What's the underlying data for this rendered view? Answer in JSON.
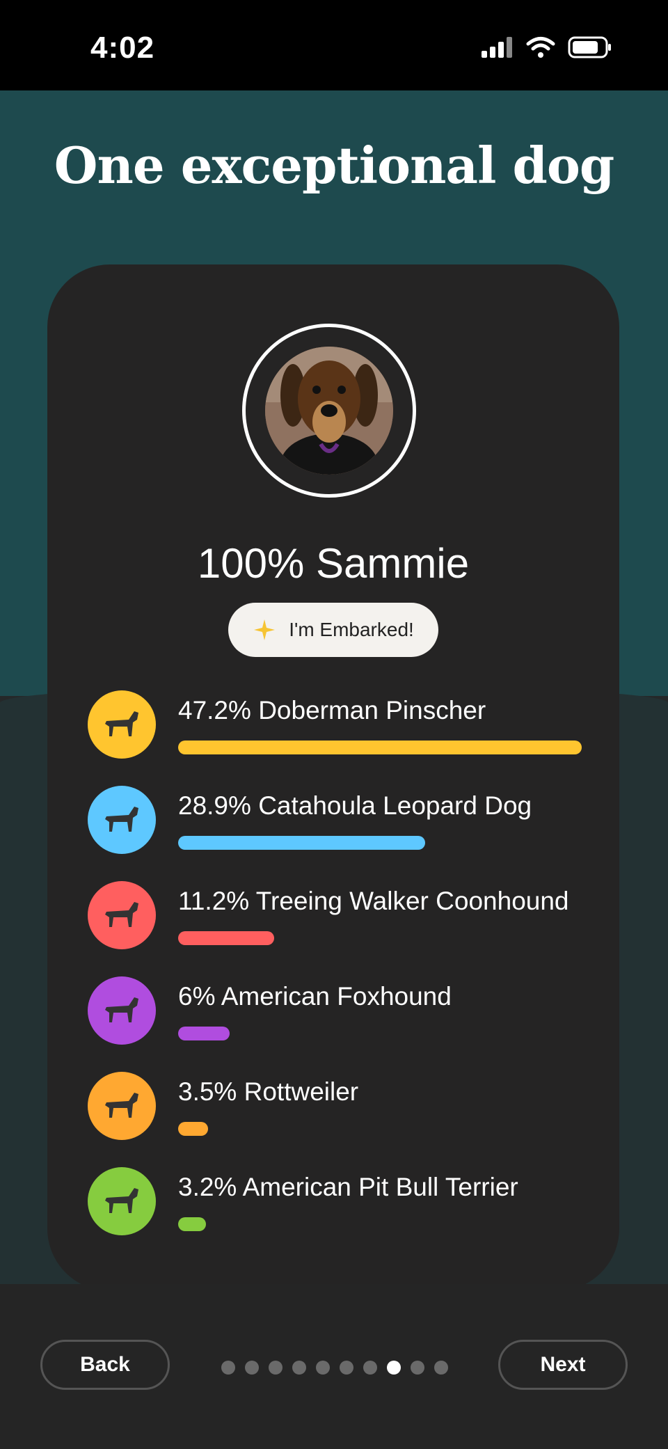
{
  "status": {
    "time": "4:02"
  },
  "title": "One exceptional dog",
  "profile": {
    "name": "100% Sammie",
    "badge": "I'm Embarked!"
  },
  "breeds": [
    {
      "label": "47.2% Doberman Pinscher",
      "percent": 47.2,
      "color": "#ffc52f"
    },
    {
      "label": "28.9% Catahoula Leopard Dog",
      "percent": 28.9,
      "color": "#5ec8ff"
    },
    {
      "label": "11.2% Treeing Walker Coonhound",
      "percent": 11.2,
      "color": "#ff5f5f"
    },
    {
      "label": "6% American Foxhound",
      "percent": 6,
      "color": "#b04ddf"
    },
    {
      "label": "3.5% Rottweiler",
      "percent": 3.5,
      "color": "#ffa831"
    },
    {
      "label": "3.2% American Pit Bull Terrier",
      "percent": 3.2,
      "color": "#86cc3f"
    }
  ],
  "nav": {
    "back": "Back",
    "next": "Next",
    "total_pages": 10,
    "current_page": 8
  },
  "icons": [
    "signal-icon",
    "wifi-icon",
    "battery-icon",
    "sparkle-icon",
    "dog-silhouette-icon"
  ]
}
